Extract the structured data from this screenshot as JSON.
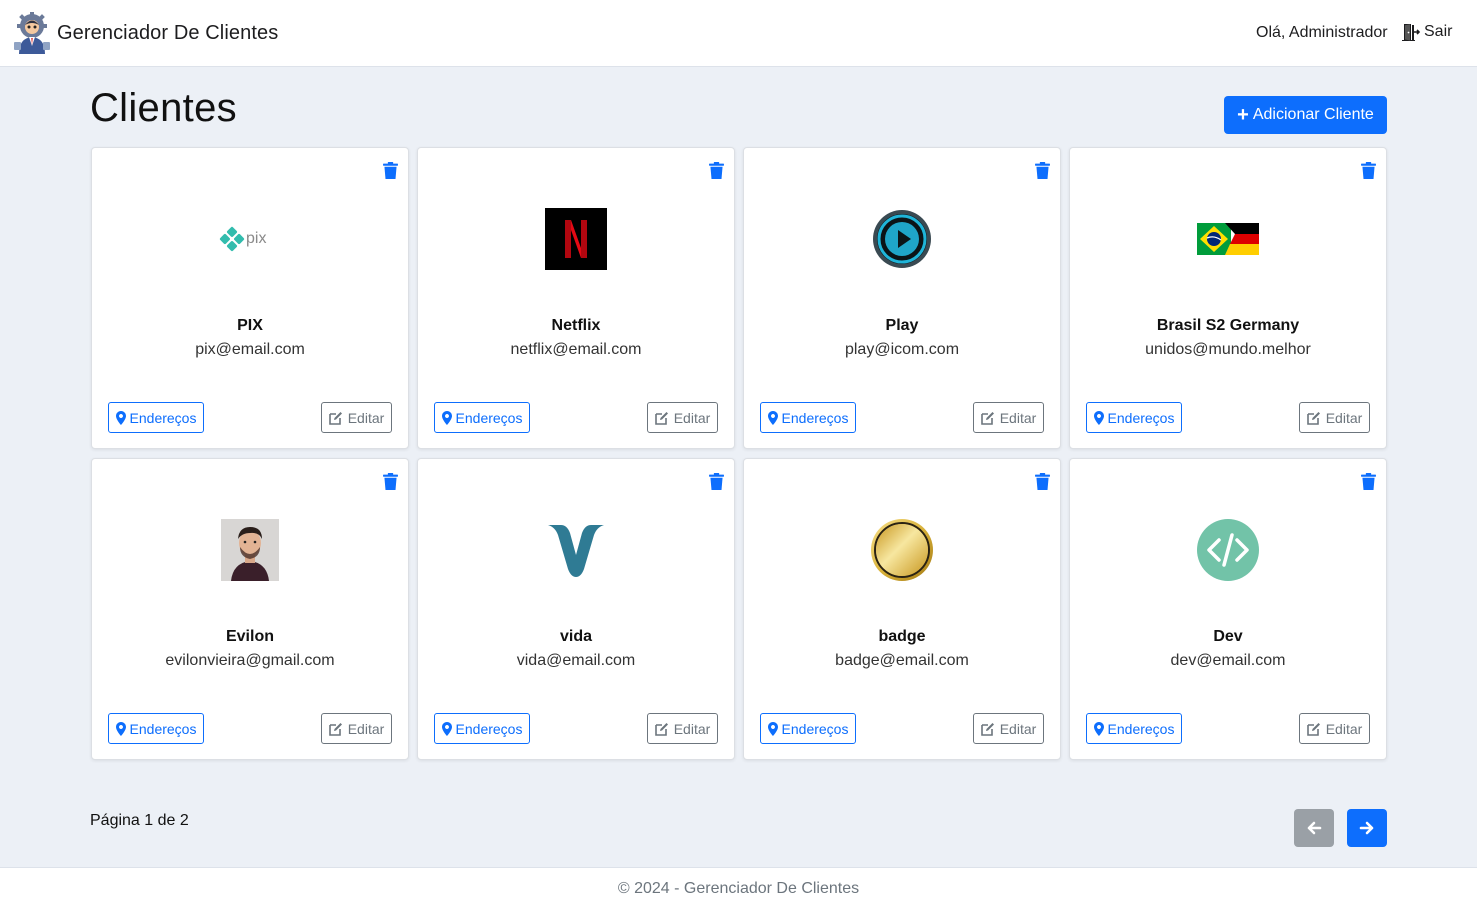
{
  "header": {
    "title": "Gerenciador De Clientes",
    "greeting": "Olá, Administrador",
    "logout_label": "Sair",
    "logo_icon": "admin-avatar-icon"
  },
  "page": {
    "title": "Clientes",
    "add_button_label": "Adicionar Cliente"
  },
  "clients": [
    {
      "name": "PIX",
      "email": "pix@email.com",
      "logo": "pix-logo"
    },
    {
      "name": "Netflix",
      "email": "netflix@email.com",
      "logo": "netflix-logo"
    },
    {
      "name": "Play",
      "email": "play@icom.com",
      "logo": "play-logo"
    },
    {
      "name": "Brasil S2 Germany",
      "email": "unidos@mundo.melhor",
      "logo": "brazil-germany-flag"
    },
    {
      "name": "Evilon",
      "email": "evilonvieira@gmail.com",
      "logo": "profile-photo"
    },
    {
      "name": "vida",
      "email": "vida@email.com",
      "logo": "vida-logo"
    },
    {
      "name": "badge",
      "email": "badge@email.com",
      "logo": "gold-badge"
    },
    {
      "name": "Dev",
      "email": "dev@email.com",
      "logo": "code-icon"
    }
  ],
  "card_actions": {
    "addresses_label": "Endereços",
    "edit_label": "Editar"
  },
  "pagination": {
    "info": "Página 1 de 2"
  },
  "footer": {
    "text": "© 2024 - Gerenciador De Clientes"
  },
  "colors": {
    "primary": "#0d6efd",
    "secondary": "#6c757d",
    "background": "#ecf0f6"
  }
}
